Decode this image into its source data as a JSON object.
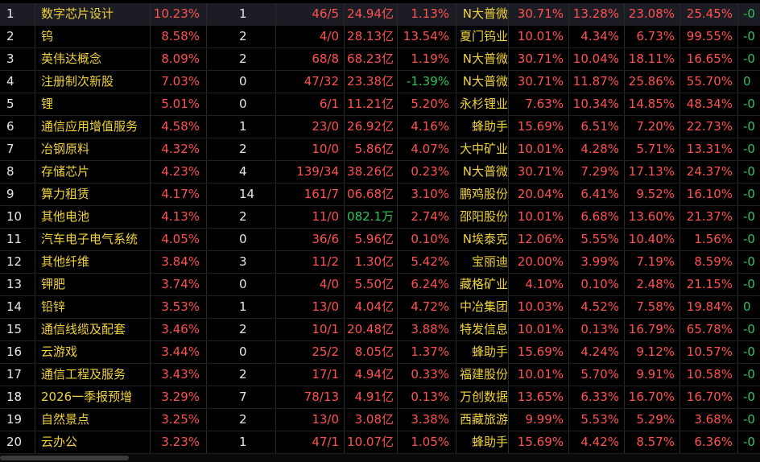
{
  "table": {
    "rows": [
      {
        "idx": "1",
        "name": "数字芯片设计",
        "chg": "10.23%",
        "n1": "1",
        "ratio": "46/5",
        "amount": "24.94亿",
        "pct": "1.13%",
        "leader": "N大普微",
        "lpct": "30.71%",
        "p1": "13.28%",
        "p2": "23.08%",
        "p3": "25.45%",
        "tail": "-0",
        "selected": true
      },
      {
        "idx": "2",
        "name": "钨",
        "chg": "8.58%",
        "n1": "2",
        "ratio": "4/0",
        "amount": "28.13亿",
        "pct": "13.54%",
        "leader": "夏门钨业",
        "lpct": "10.01%",
        "p1": "4.34%",
        "p2": "6.73%",
        "p3": "99.55%",
        "tail": "-0"
      },
      {
        "idx": "3",
        "name": "英伟达概念",
        "chg": "8.09%",
        "n1": "2",
        "ratio": "68/8",
        "amount": "68.23亿",
        "pct": "1.19%",
        "leader": "N大普微",
        "lpct": "30.71%",
        "p1": "10.04%",
        "p2": "18.11%",
        "p3": "16.65%",
        "tail": "-0"
      },
      {
        "idx": "4",
        "name": "注册制次新股",
        "chg": "7.03%",
        "n1": "0",
        "ratio": "47/32",
        "amount": "23.38亿",
        "pct": "-1.39%",
        "pct_down": true,
        "leader": "N大普微",
        "lpct": "30.71%",
        "p1": "11.87%",
        "p2": "25.86%",
        "p3": "55.70%",
        "tail": "0"
      },
      {
        "idx": "5",
        "name": "锂",
        "chg": "5.01%",
        "n1": "0",
        "ratio": "6/1",
        "amount": "11.21亿",
        "pct": "5.20%",
        "leader": "永杉锂业",
        "lpct": "7.63%",
        "p1": "10.34%",
        "p2": "14.85%",
        "p3": "48.34%",
        "tail": "-0"
      },
      {
        "idx": "6",
        "name": "通信应用增值服务",
        "chg": "4.58%",
        "n1": "1",
        "ratio": "23/0",
        "amount": "26.92亿",
        "pct": "4.16%",
        "leader": "蜂助手",
        "lpct": "15.69%",
        "p1": "6.51%",
        "p2": "7.20%",
        "p3": "22.73%",
        "tail": "-0"
      },
      {
        "idx": "7",
        "name": "冶钢原料",
        "chg": "4.32%",
        "n1": "2",
        "ratio": "10/0",
        "amount": "5.86亿",
        "pct": "4.07%",
        "leader": "大中矿业",
        "lpct": "10.01%",
        "p1": "4.28%",
        "p2": "5.71%",
        "p3": "13.31%",
        "tail": "-0"
      },
      {
        "idx": "8",
        "name": "存储芯片",
        "chg": "4.23%",
        "n1": "4",
        "ratio": "139/34",
        "amount": "38.26亿",
        "pct": "0.23%",
        "leader": "N大普微",
        "lpct": "30.71%",
        "p1": "7.29%",
        "p2": "17.13%",
        "p3": "24.37%",
        "tail": "-0"
      },
      {
        "idx": "9",
        "name": "算力租赁",
        "chg": "4.17%",
        "n1": "14",
        "ratio": "161/7",
        "amount": "06.68亿",
        "pct": "3.10%",
        "leader": "鹏鸡股份",
        "lpct": "20.04%",
        "p1": "6.41%",
        "p2": "9.52%",
        "p3": "16.10%",
        "tail": "-0"
      },
      {
        "idx": "10",
        "name": "其他电池",
        "chg": "4.13%",
        "n1": "2",
        "ratio": "11/0",
        "amount": "082.1万",
        "amount_down": true,
        "pct": "2.74%",
        "leader": "邵阳股份",
        "lpct": "10.01%",
        "p1": "6.68%",
        "p2": "13.60%",
        "p3": "21.37%",
        "tail": "-0"
      },
      {
        "idx": "11",
        "name": "汽车电子电气系统",
        "chg": "4.05%",
        "n1": "0",
        "ratio": "36/6",
        "amount": "5.96亿",
        "pct": "0.10%",
        "leader": "N埃泰克",
        "lpct": "12.06%",
        "p1": "5.55%",
        "p2": "10.40%",
        "p3": "1.56%",
        "tail": "-0"
      },
      {
        "idx": "12",
        "name": "其他纤维",
        "chg": "3.84%",
        "n1": "3",
        "ratio": "11/2",
        "amount": "1.30亿",
        "pct": "5.42%",
        "leader": "宝丽迪",
        "lpct": "20.00%",
        "p1": "3.99%",
        "p2": "7.19%",
        "p3": "8.59%",
        "tail": "-0"
      },
      {
        "idx": "13",
        "name": "钾肥",
        "chg": "3.74%",
        "n1": "0",
        "ratio": "4/0",
        "amount": "5.50亿",
        "pct": "6.24%",
        "leader": "藏格矿业",
        "lpct": "4.10%",
        "p1": "0.10%",
        "p2": "2.48%",
        "p3": "21.15%",
        "tail": "-0"
      },
      {
        "idx": "14",
        "name": "铅锌",
        "chg": "3.53%",
        "n1": "1",
        "ratio": "13/0",
        "amount": "4.04亿",
        "pct": "4.72%",
        "leader": "中冶集团",
        "lpct": "10.03%",
        "p1": "4.52%",
        "p2": "7.58%",
        "p3": "19.84%",
        "tail": "0"
      },
      {
        "idx": "15",
        "name": "通信线缆及配套",
        "chg": "3.46%",
        "n1": "2",
        "ratio": "10/1",
        "amount": "20.48亿",
        "pct": "3.88%",
        "leader": "特发信息",
        "lpct": "10.01%",
        "p1": "0.13%",
        "p2": "16.79%",
        "p3": "65.78%",
        "tail": "-0"
      },
      {
        "idx": "16",
        "name": "云游戏",
        "chg": "3.44%",
        "n1": "0",
        "ratio": "25/2",
        "amount": "8.05亿",
        "pct": "1.37%",
        "leader": "蜂助手",
        "lpct": "15.69%",
        "p1": "4.24%",
        "p2": "9.12%",
        "p3": "10.57%",
        "tail": "-0"
      },
      {
        "idx": "17",
        "name": "通信工程及服务",
        "chg": "3.43%",
        "n1": "2",
        "ratio": "17/1",
        "amount": "4.94亿",
        "pct": "0.33%",
        "leader": "福建股份",
        "lpct": "10.01%",
        "p1": "5.70%",
        "p2": "9.91%",
        "p3": "10.58%",
        "tail": "-0"
      },
      {
        "idx": "18",
        "name": "2026一季报预增",
        "chg": "3.29%",
        "n1": "7",
        "ratio": "78/13",
        "amount": "4.91亿",
        "pct": "0.13%",
        "leader": "万创数据",
        "lpct": "13.65%",
        "p1": "6.33%",
        "p2": "16.70%",
        "p3": "16.70%",
        "tail": "-0"
      },
      {
        "idx": "19",
        "name": "自然景点",
        "chg": "3.25%",
        "n1": "2",
        "ratio": "13/0",
        "amount": "3.08亿",
        "pct": "3.38%",
        "leader": "西藏旅游",
        "lpct": "9.99%",
        "p1": "5.53%",
        "p2": "5.29%",
        "p3": "3.68%",
        "tail": "-0"
      },
      {
        "idx": "20",
        "name": "云办公",
        "chg": "3.23%",
        "n1": "1",
        "ratio": "47/1",
        "amount": "10.07亿",
        "pct": "1.05%",
        "leader": "蜂助手",
        "lpct": "15.69%",
        "p1": "4.42%",
        "p2": "8.57%",
        "p3": "6.36%",
        "tail": "-0"
      }
    ]
  },
  "colors": {
    "up": "#ff5252",
    "down": "#2fc45a",
    "name": "#f0d23c",
    "text": "#e6e6e6",
    "background": "#000000"
  }
}
